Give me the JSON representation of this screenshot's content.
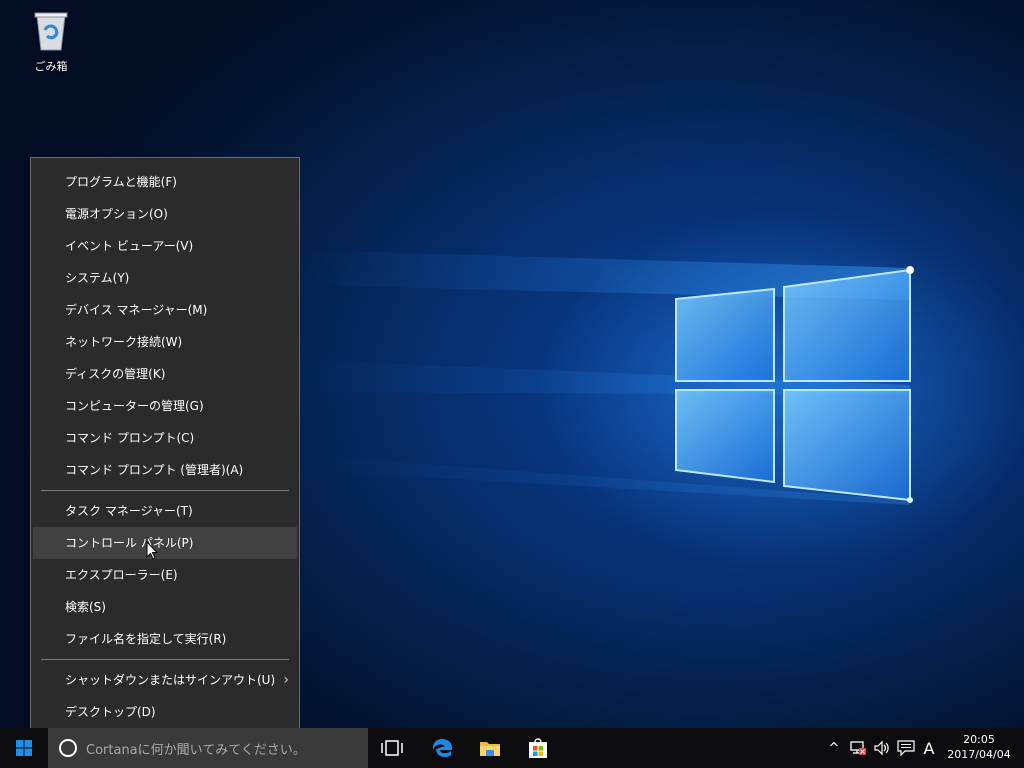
{
  "desktop": {
    "icons": [
      {
        "label": "ごみ箱",
        "icon": "recycle-bin-icon"
      }
    ]
  },
  "context_menu": {
    "groups": [
      [
        {
          "label": "プログラムと機能(F)"
        },
        {
          "label": "電源オプション(O)"
        },
        {
          "label": "イベント ビューアー(V)"
        },
        {
          "label": "システム(Y)"
        },
        {
          "label": "デバイス マネージャー(M)"
        },
        {
          "label": "ネットワーク接続(W)"
        },
        {
          "label": "ディスクの管理(K)"
        },
        {
          "label": "コンピューターの管理(G)"
        },
        {
          "label": "コマンド プロンプト(C)"
        },
        {
          "label": "コマンド プロンプト (管理者)(A)"
        }
      ],
      [
        {
          "label": "タスク マネージャー(T)"
        },
        {
          "label": "コントロール パネル(P)",
          "highlighted": true
        },
        {
          "label": "エクスプローラー(E)"
        },
        {
          "label": "検索(S)"
        },
        {
          "label": "ファイル名を指定して実行(R)"
        }
      ],
      [
        {
          "label": "シャットダウンまたはサインアウト(U)",
          "has_submenu": true,
          "submenu_arrow": "›"
        },
        {
          "label": "デスクトップ(D)"
        }
      ]
    ]
  },
  "taskbar": {
    "search_placeholder": "Cortanaに何か聞いてみてください。",
    "pinned": [
      "task-view-icon",
      "edge-icon",
      "file-explorer-icon",
      "store-icon"
    ],
    "tray": {
      "chevron": "^",
      "ime_mode": "A"
    },
    "clock": {
      "time": "20:05",
      "date": "2017/04/04"
    }
  },
  "colors": {
    "menu_bg": "#2b2b2b",
    "menu_hover": "#414141",
    "taskbar_bg": "#0c0c0e",
    "search_bg": "#3a3a3a",
    "accent_blue": "#1e90ff"
  }
}
